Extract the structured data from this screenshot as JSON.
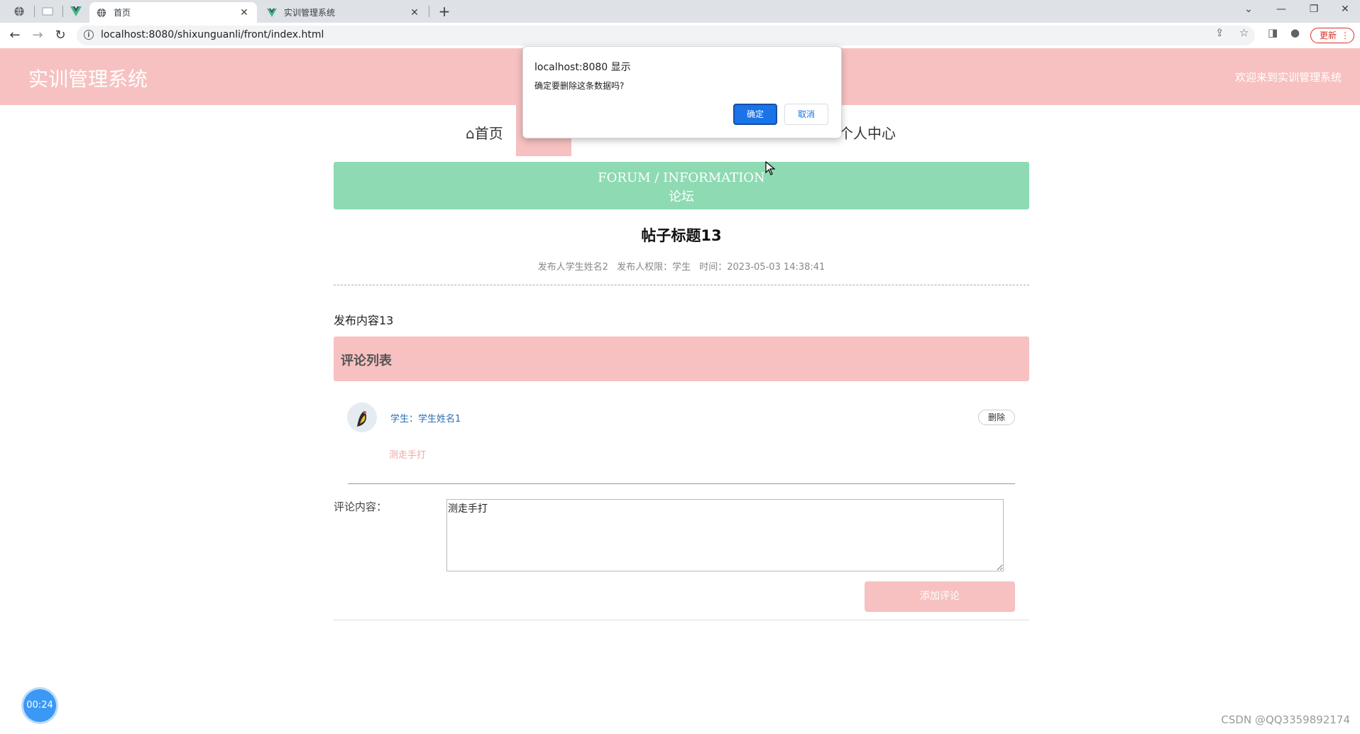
{
  "browser": {
    "tabs": [
      {
        "label": "首页",
        "active": true
      },
      {
        "label": "实训管理系统",
        "active": false
      }
    ],
    "url": "localhost:8080/shixunguanli/front/index.html",
    "update_label": "更新"
  },
  "site": {
    "title": "实训管理系统",
    "welcome": "欢迎来到实训管理系统"
  },
  "nav": {
    "home": "首页",
    "personal": "个人中心"
  },
  "banner": {
    "en": "FORUM / INFORMATION",
    "cn": "论坛"
  },
  "post": {
    "title": "帖子标题13",
    "author": "发布人学生姓名2",
    "role": "发布人权限：学生",
    "time": "时间：2023-05-03 14:38:41",
    "content": "发布内容13"
  },
  "comments": {
    "header": "评论列表",
    "items": [
      {
        "user": "学生：学生姓名1",
        "text": "测走手打",
        "delete_label": "删除"
      }
    ]
  },
  "form": {
    "label": "评论内容：",
    "value": "测走手打",
    "submit_label": "添加评论"
  },
  "dialog": {
    "title": "localhost:8080 显示",
    "message": "确定要删除这条数据吗?",
    "ok_label": "确定",
    "cancel_label": "取消"
  },
  "overlay": {
    "timer": "00:24",
    "watermark": "CSDN @QQ3359892174"
  },
  "colors": {
    "theme_pink": "#f7c1c1",
    "banner_green": "#8edab3",
    "dialog_blue": "#1a73e8"
  }
}
